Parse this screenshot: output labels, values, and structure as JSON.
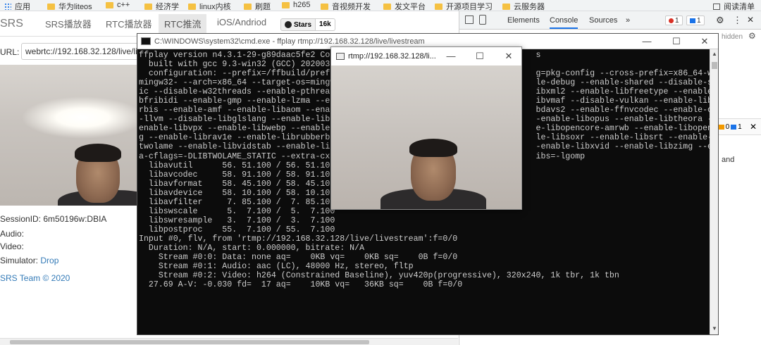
{
  "bookmarks": [
    {
      "label": "应用"
    },
    {
      "label": "华为liteos"
    },
    {
      "label": "c++"
    },
    {
      "label": "经济学"
    },
    {
      "label": "linux内核"
    },
    {
      "label": "刷题"
    },
    {
      "label": "h265"
    },
    {
      "label": "音视频开发"
    },
    {
      "label": "发文平台"
    },
    {
      "label": "开源项目学习"
    },
    {
      "label": "云服务器"
    },
    {
      "label": "阅读清单"
    }
  ],
  "nav": {
    "brand": "SRS",
    "tabs": [
      "SRS播放器",
      "RTC播放器",
      "RTC推流",
      "iOS/Andriod"
    ],
    "stars_label": "Stars",
    "stars_count": "16k"
  },
  "url": {
    "label": "URL:",
    "value": "webrtc://192.168.32.128/live/li"
  },
  "session": {
    "label": "SessionID:",
    "value": "6m50196w:DBIA"
  },
  "audio_label": "Audio:",
  "video_label": "Video:",
  "simulator": {
    "label": "Simulator:",
    "link": "Drop"
  },
  "footer": "SRS Team © 2020",
  "devtools": {
    "tabs": [
      "Elements",
      "Console",
      "Sources",
      "»"
    ],
    "errors": "1",
    "messages": "1",
    "hidden": "hidden",
    "warn_count": "0",
    "info_count": "1",
    "zero_count": "0",
    "and_text": "and"
  },
  "cmd": {
    "title": "C:\\WINDOWS\\system32\\cmd.exe - ffplay  rtmp://192.168.32.128/live/livestream",
    "lines": [
      "ffplay version n4.3.1-29-g89daac5fe2 Copy                                        s",
      "  built with gcc 9.3-win32 (GCC) 2020032",
      "  configuration: --prefix=/ffbuild/prefix                                        g=pkg-config --cross-prefix=x86_64-w64-",
      "mingw32- --arch=x86_64 --target-os=mingw3                                        le-debug --enable-shared --disable-stat",
      "ic --disable-w32threads --enable-pthreads                                        ibxml2 --enable-libfreetype --enable-li",
      "bfribidi --enable-gmp --enable-lzma --ena                                        ibvmaf --disable-vulkan --enable-libvo",
      "rbis --enable-amf --enable-libaom --enabl                                        bdavs2 --enable-ffnvcodec --enable-cuda",
      "-llvm --disable-libglslang --enable-libas                                        -enable-libopus --enable-libtheora --",
      "enable-libvpx --enable-libwebp --enable-l                                        e-libopencore-amrwb --enable-libopenjpe",
      "g --enable-librav1e --enable-librubberban                                        le-libsoxr --enable-libsrt --enable-lib",
      "twolame --enable-libvidstab --enable-libx                                        -enable-libxvid --enable-libzimg --extr",
      "a-cflags=-DLIBTWOLAME_STATIC --extra-cxxf                                        ibs=-lgomp",
      "  libavutil      56. 51.100 / 56. 51.100",
      "  libavcodec     58. 91.100 / 58. 91.100",
      "  libavformat    58. 45.100 / 58. 45.100",
      "  libavdevice    58. 10.100 / 58. 10.100",
      "  libavfilter     7. 85.100 /  7. 85.100",
      "  libswscale      5.  7.100 /  5.  7.100",
      "  libswresample   3.  7.100 /  3.  7.100",
      "  libpostproc    55.  7.100 / 55.  7.100",
      "Input #0, flv, from 'rtmp://192.168.32.128/live/livestream':f=0/0",
      "  Duration: N/A, start: 0.000000, bitrate: N/A",
      "    Stream #0:0: Data: none aq=    0KB vq=    0KB sq=    0B f=0/0",
      "    Stream #0:1: Audio: aac (LC), 48000 Hz, stereo, fltp",
      "    Stream #0:2: Video: h264 (Constrained Baseline), yuv420p(progressive), 320x240, 1k tbr, 1k tbn",
      "  27.69 A-V: -0.030 fd=  17 aq=    10KB vq=   36KB sq=    0B f=0/0"
    ]
  },
  "ffplay": {
    "title": "rtmp://192.168.32.128/li..."
  },
  "window_controls": {
    "minimize": "—",
    "maximize": "☐",
    "close": "✕"
  }
}
